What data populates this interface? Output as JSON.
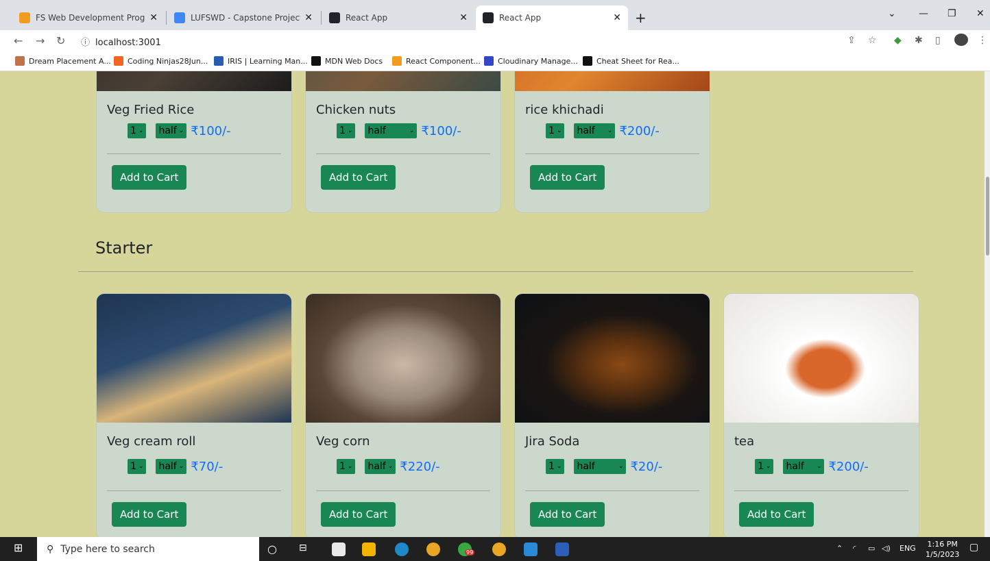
{
  "browser": {
    "tabs": [
      {
        "title": "FS Web Development Program M",
        "favicon_color": "#f29c1f"
      },
      {
        "title": "LUFSWD - Capstone Project - Go",
        "favicon_color": "#4285f4"
      },
      {
        "title": "React App",
        "favicon_color": "#20232a"
      },
      {
        "title": "React App",
        "favicon_color": "#20232a"
      }
    ],
    "url": "localhost:3001",
    "bookmarks": [
      {
        "label": "Dream Placement A...",
        "color": "#c0724a"
      },
      {
        "label": "Coding Ninjas28Jun...",
        "color": "#f26522"
      },
      {
        "label": "IRIS | Learning Man...",
        "color": "#2a5db0"
      },
      {
        "label": "MDN Web Docs",
        "color": "#111111"
      },
      {
        "label": "React Component...",
        "color": "#f29c1f"
      },
      {
        "label": "Cloudinary Manage...",
        "color": "#3448c5"
      },
      {
        "label": "Cheat Sheet for Rea...",
        "color": "#111111"
      }
    ]
  },
  "page": {
    "top_cards": [
      {
        "name": "Veg Fried Rice",
        "qty": "1",
        "size": "half",
        "price": "₹100/-",
        "button": "Add to Cart",
        "img_colors": [
          "#2e2a26",
          "#4a4036",
          "#1c1c1c"
        ]
      },
      {
        "name": "Chicken nuts",
        "qty": "1",
        "size": "half",
        "price": "₹100/-",
        "button": "Add to Cart",
        "img_colors": [
          "#44524a",
          "#7a5a3c",
          "#3b4a44"
        ]
      },
      {
        "name": "rice khichadi",
        "qty": "1",
        "size": "half",
        "price": "₹200/-",
        "button": "Add to Cart",
        "img_colors": [
          "#c85a22",
          "#e0862e",
          "#a3461a"
        ]
      }
    ],
    "section": {
      "title": "Starter"
    },
    "starter_cards": [
      {
        "name": "Veg cream roll",
        "qty": "1",
        "size": "half",
        "price": "₹70/-",
        "button": "Add to Cart",
        "img_colors": [
          "#2c4a6e",
          "#d9b57a",
          "#1f3552"
        ]
      },
      {
        "name": "Veg corn",
        "qty": "1",
        "size": "half",
        "price": "₹220/-",
        "button": "Add to Cart",
        "img_colors": [
          "#5a4636",
          "#cbb9a6",
          "#3a2d22"
        ]
      },
      {
        "name": "Jira Soda",
        "qty": "1",
        "size": "half",
        "price": "₹20/-",
        "button": "Add to Cart",
        "img_colors": [
          "#0d1014",
          "#8a4a14",
          "#1a1512"
        ]
      },
      {
        "name": "tea",
        "qty": "1",
        "size": "half",
        "price": "₹200/-",
        "button": "Add to Cart",
        "img_colors": [
          "#f4f4f2",
          "#e8e6e2",
          "#d9662a"
        ]
      }
    ]
  },
  "taskbar": {
    "search_placeholder": "Type here to search",
    "lang": "ENG",
    "time": "1:16 PM",
    "date": "1/5/2023",
    "badge": "99"
  },
  "colors": {
    "page_bg": "#d6d69a",
    "card_bg": "#cdd8cd",
    "button": "#198754",
    "price": "#0d6efd"
  }
}
